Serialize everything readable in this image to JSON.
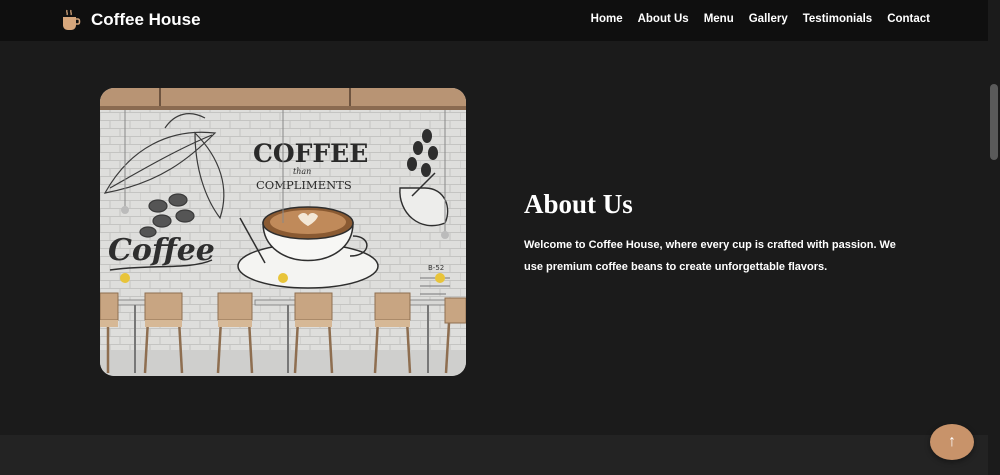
{
  "header": {
    "brand": "Coffee House",
    "nav": [
      "Home",
      "About Us",
      "Menu",
      "Gallery",
      "Testimonials",
      "Contact"
    ]
  },
  "about": {
    "title": "About Us",
    "text": "Welcome to Coffee House, where every cup is crafted with passion. We use premium coffee beans to create unforgettable flavors.",
    "image": {
      "wall_heading": "COFFEE",
      "wall_than": "than",
      "wall_sub": "COMPLIMENTS",
      "wall_script": "Coffee",
      "board_text": "B-52"
    }
  },
  "back_to_top": {
    "symbol": "↑"
  },
  "colors": {
    "background": "#1b1b1b",
    "navbar": "#0f0f0f",
    "accent": "#c8936a",
    "text": "#ffffff"
  },
  "icons": {
    "brand": "coffee-cup-icon",
    "back_to_top": "arrow-up-icon"
  }
}
